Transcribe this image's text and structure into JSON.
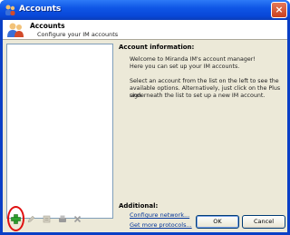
{
  "window": {
    "title": "Accounts",
    "close_label": "×"
  },
  "header": {
    "title": "Accounts",
    "subtitle": "Configure your IM accounts"
  },
  "info": {
    "title": "Account information:",
    "welcome_line1": "Welcome to Miranda IM's account manager!",
    "welcome_line2": "Here you can set up your IM accounts.",
    "instructions_line1": "Select an account from the list on the left to see the",
    "instructions_line2": "available options. Alternatively, just click on the Plus sign",
    "instructions_line3": "underneath the list to set up a new IM account."
  },
  "additional": {
    "title": "Additional:",
    "configure_network": "Configure network...",
    "get_more_protocols": "Get more protocols..."
  },
  "buttons": {
    "ok": "OK",
    "cancel": "Cancel"
  },
  "colors": {
    "title_bar": "#0f56e6",
    "dialog_bg": "#ece9d8",
    "add_icon": "#2ea12e",
    "highlight_ring": "#e01010",
    "link": "#003399"
  },
  "icons": [
    "accounts-icon",
    "users-icon",
    "add-icon",
    "edit-icon",
    "options-icon",
    "connect-icon",
    "delete-icon",
    "close-icon"
  ]
}
